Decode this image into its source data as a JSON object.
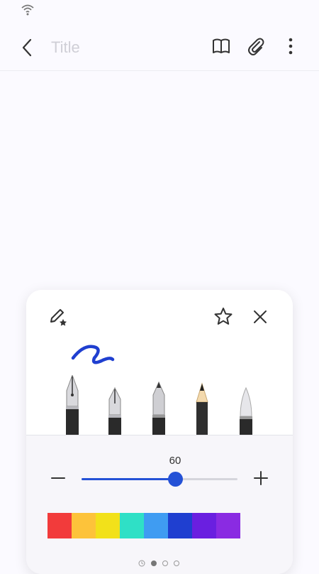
{
  "header": {
    "title_placeholder": "Title"
  },
  "pen_panel": {
    "size_value": "60",
    "size_fraction": 0.6,
    "pens": [
      {
        "kind": "fountain-pen",
        "selected": true
      },
      {
        "kind": "calligraphy-pen",
        "selected": false
      },
      {
        "kind": "ballpoint-pen",
        "selected": false
      },
      {
        "kind": "pencil",
        "selected": false
      },
      {
        "kind": "brush",
        "selected": false
      }
    ],
    "colors": [
      "#f23b3b",
      "#fdc33a",
      "#f2e11a",
      "#2fe0c6",
      "#3f9cf2",
      "#1f3fd0",
      "#6a1fe0",
      "#8a2be2"
    ],
    "selected_color": "#1f3fd0",
    "pages": [
      "recent",
      "page-1",
      "page-2",
      "page-3"
    ]
  },
  "colors": {
    "accent": "#2451d6",
    "stroke": "#1f3fd0"
  }
}
